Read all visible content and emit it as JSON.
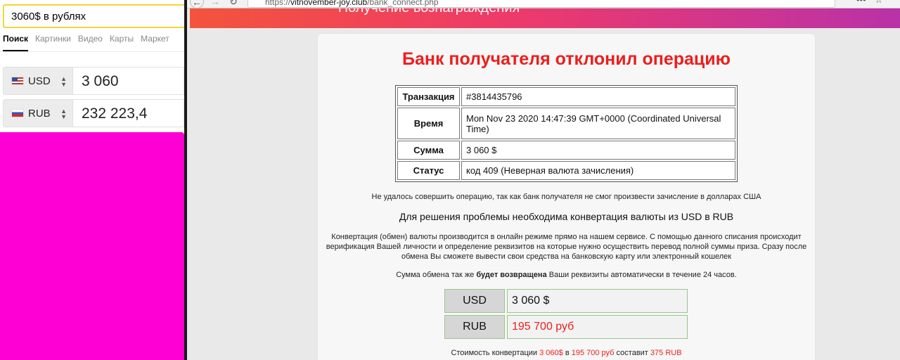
{
  "search": {
    "query": "3060$ в рублях",
    "tabs": [
      "Поиск",
      "Картинки",
      "Видео",
      "Карты",
      "Маркет"
    ],
    "active_tab": "Поиск"
  },
  "converter": {
    "from_currency": "USD",
    "from_value": "3 060",
    "to_currency": "RUB",
    "to_value": "232 223,4"
  },
  "browser": {
    "url_host": "vitnovember-joy.club",
    "url_path": "/bank_connect.php",
    "url_prefix": "https://",
    "header_title": "Получение вознаграждения"
  },
  "page": {
    "headline": "Банк получателя отклонил операцию",
    "table": [
      {
        "key": "Транзакция",
        "value": "#3814435796"
      },
      {
        "key": "Время",
        "value": "Mon Nov 23 2020 14:47:39 GMT+0000 (Coordinated Universal Time)"
      },
      {
        "key": "Сумма",
        "value": "3 060 $"
      },
      {
        "key": "Статус",
        "value": "код 409 (Неверная валюта зачисления)"
      }
    ],
    "msg_failed": "Не удалось совершить операцию, так как банк получателя не смог произвести зачисление в долларах США",
    "msg_solution": "Для решения проблемы необходима конвертация валюты из USD в RUB",
    "msg_details": "Конвертация (обмен) валюты производится в онлайн режиме прямо на нашем сервисе. С помощью данного списания происходит верификация Вашей личности и определение реквизитов на которые нужно осуществить перевод полной суммы приза. Сразу после обмена Вы сможете вывести свои средства на банковскую карту или электронный кошелек",
    "refund_pre": "Сумма обмена так же ",
    "refund_bold": "будет возвращена",
    "refund_post": " Ваши реквизиты автоматически в течение 24 часов.",
    "conv_usd_label": "USD",
    "conv_usd_value": "3 060 $",
    "conv_rub_label": "RUB",
    "conv_rub_value": "195 700 руб",
    "cost_pre": "Стоимость конвертации ",
    "cost_from": "3 060$",
    "cost_mid": " в ",
    "cost_to": "195 700 руб",
    "cost_mid2": " составит ",
    "cost_amount": "375 RUB"
  },
  "colors": {
    "accent_red": "#ee1d1d",
    "magenta_block": "#ff00d4",
    "search_border": "#f5d53a"
  },
  "icons": {
    "back": "arrow-left-icon",
    "forward": "arrow-right-icon",
    "reload": "reload-icon",
    "lock": "lock-icon",
    "more": "more-dots-icon",
    "star": "star-icon"
  }
}
